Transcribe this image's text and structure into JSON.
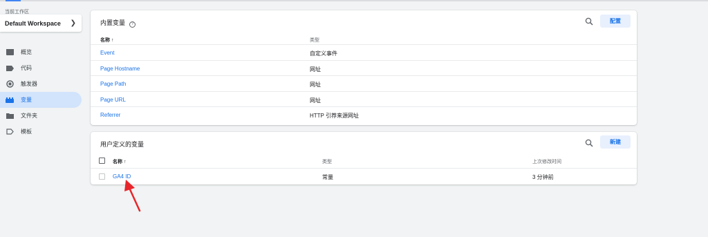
{
  "sidebar": {
    "workspace_label": "当前工作区",
    "workspace_name": "Default Workspace",
    "items": [
      {
        "label": "概览",
        "icon": "overview-icon"
      },
      {
        "label": "代码",
        "icon": "tag-icon"
      },
      {
        "label": "触发器",
        "icon": "trigger-icon"
      },
      {
        "label": "变量",
        "icon": "variables-icon",
        "active": true
      },
      {
        "label": "文件夹",
        "icon": "folder-icon"
      },
      {
        "label": "模板",
        "icon": "template-icon"
      }
    ]
  },
  "builtin": {
    "title": "内置变量",
    "help": "?",
    "button": "配置",
    "col_name": "名称 ↑",
    "col_type": "类型",
    "rows": [
      {
        "name": "Event",
        "type": "自定义事件"
      },
      {
        "name": "Page Hostname",
        "type": "网址"
      },
      {
        "name": "Page Path",
        "type": "网址"
      },
      {
        "name": "Page URL",
        "type": "网址"
      },
      {
        "name": "Referrer",
        "type": "HTTP 引荐来源网址"
      }
    ]
  },
  "user_defined": {
    "title": "用户定义的变量",
    "button": "新建",
    "col_name": "名称 ↑",
    "col_type": "类型",
    "col_modified": "上次修改时间",
    "rows": [
      {
        "name": "GA4 ID",
        "type": "常量",
        "modified": "3 分钟前"
      }
    ]
  },
  "colors": {
    "accent": "#1a73e8",
    "active_bg": "#d2e3fc",
    "annotation_arrow": "#e8252b"
  }
}
